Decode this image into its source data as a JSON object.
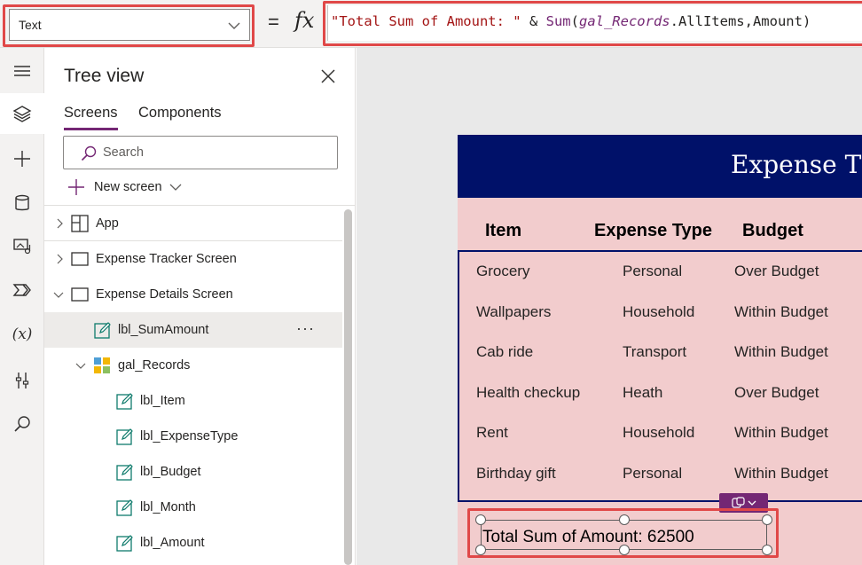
{
  "formula_bar": {
    "property": "Text",
    "equals": "=",
    "fx": "fx",
    "formula": {
      "string": "\"Total Sum of Amount: \"",
      "ampersand": " & ",
      "fn": "Sum",
      "open": "(",
      "control": "gal_Records",
      "rest": ".AllItems,Amount)"
    }
  },
  "rail": {
    "items": [
      "hamburger-icon",
      "layers-icon",
      "plus-icon",
      "database-icon",
      "media-icon",
      "power-automate-icon",
      "variables-icon",
      "tools-icon",
      "search-icon"
    ],
    "variables_glyph": "(x)",
    "active_index": 1
  },
  "tree": {
    "title": "Tree view",
    "tabs": [
      "Screens",
      "Components"
    ],
    "search_placeholder": "Search",
    "new_screen": "New screen",
    "items": [
      {
        "label": "App",
        "type": "app",
        "expand": "collapsed",
        "indent": 0
      },
      {
        "label": "Expense Tracker Screen",
        "type": "screen",
        "expand": "collapsed",
        "indent": 0
      },
      {
        "label": "Expense Details Screen",
        "type": "screen",
        "expand": "expanded",
        "indent": 0
      },
      {
        "label": "lbl_SumAmount",
        "type": "label",
        "expand": "none",
        "indent": 1,
        "selected": true
      },
      {
        "label": "gal_Records",
        "type": "gallery",
        "expand": "expanded",
        "indent": 1
      },
      {
        "label": "lbl_Item",
        "type": "label",
        "expand": "none",
        "indent": 2
      },
      {
        "label": "lbl_ExpenseType",
        "type": "label",
        "expand": "none",
        "indent": 2
      },
      {
        "label": "lbl_Budget",
        "type": "label",
        "expand": "none",
        "indent": 2
      },
      {
        "label": "lbl_Month",
        "type": "label",
        "expand": "none",
        "indent": 2
      },
      {
        "label": "lbl_Amount",
        "type": "label",
        "expand": "none",
        "indent": 2
      }
    ],
    "more_glyph": "···"
  },
  "canvas": {
    "app_title": "Expense T",
    "headers": [
      "Item",
      "Expense Type",
      "Budget"
    ],
    "rows": [
      [
        "Grocery",
        "Personal",
        "Over Budget"
      ],
      [
        "Wallpapers",
        "Household",
        "Within Budget"
      ],
      [
        "Cab ride",
        "Transport",
        "Within Budget"
      ],
      [
        "Health checkup",
        "Heath",
        "Over Budget"
      ],
      [
        "Rent",
        "Household",
        "Within Budget"
      ],
      [
        "Birthday gift",
        "Personal",
        "Within Budget"
      ]
    ],
    "sum_label": "Total Sum of Amount: 62500"
  },
  "colors": {
    "accent": "#742774",
    "header_bg": "#001169",
    "screen_bg": "#f2cccd",
    "highlight": "#e04848"
  }
}
